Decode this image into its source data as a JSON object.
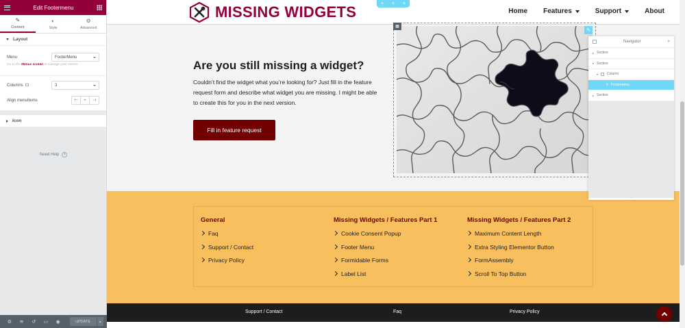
{
  "panel": {
    "title": "Edit Footermenu",
    "tabs": [
      {
        "label": "Content",
        "icon": "pencil-icon"
      },
      {
        "label": "Style",
        "icon": "half-circle-icon"
      },
      {
        "label": "Advanced",
        "icon": "gear-icon"
      }
    ],
    "layout_section": "Layout",
    "menu_label": "Menu",
    "menu_value": "FooterMenu",
    "hint_prefix": "Go to the",
    "hint_link": "Menus screen",
    "hint_suffix": "to manage your menus.",
    "columns_label": "Columns",
    "columns_value": "3",
    "align_label": "Align menuItems",
    "icon_section": "Icon",
    "need_help": "Need Help",
    "update_label": "UPDATE"
  },
  "site": {
    "brand": "MISSING WIDGETS",
    "nav": [
      {
        "label": "Home",
        "dropdown": false
      },
      {
        "label": "Features",
        "dropdown": true
      },
      {
        "label": "Support",
        "dropdown": true
      },
      {
        "label": "About",
        "dropdown": false
      }
    ],
    "hero": {
      "title": "Are you still missing a widget?",
      "text": "Couldn’t find the widget what you’re looking for? Just fill in the feature request form and describe what widget you are missing. I might be able to create this for you in the next version.",
      "cta": "Fill in feature request"
    },
    "footer_columns": [
      {
        "heading": "General",
        "items": [
          "Faq",
          "Support / Contact",
          "Privacy Policy"
        ]
      },
      {
        "heading": "Missing Widgets / Features Part 1",
        "items": [
          "Cookie Consent Popup",
          "Footer Menu",
          "Formidable Forms",
          "Label List"
        ]
      },
      {
        "heading": "Missing Widgets / Features Part 2",
        "items": [
          "Maximum Content Length",
          "Extra Styling Elementor Button",
          "FormAssembly",
          "Scroll To Top Button"
        ]
      }
    ],
    "bottom_links": [
      "Support / Contact",
      "Faq",
      "Privacy Policy"
    ]
  },
  "navigator": {
    "title": "Navigator",
    "rows": [
      {
        "label": "Section",
        "indent": 0
      },
      {
        "label": "Section",
        "indent": 0
      },
      {
        "label": "Column",
        "indent": 1
      },
      {
        "label": "Footermenu",
        "indent": 2
      },
      {
        "label": "Section",
        "indent": 0
      }
    ]
  },
  "colors": {
    "brand": "#93003c",
    "cta": "#730000",
    "footer_bg": "#f8bf5f",
    "editor_accent": "#71d7f7"
  }
}
